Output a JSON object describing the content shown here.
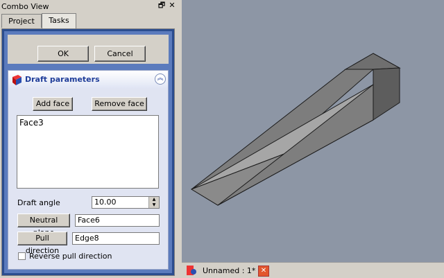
{
  "combo": {
    "title": "Combo View",
    "tabs": [
      {
        "label": "Project"
      },
      {
        "label": "Tasks"
      }
    ]
  },
  "dialog": {
    "ok_label": "OK",
    "cancel_label": "Cancel"
  },
  "draft": {
    "title": "Draft parameters",
    "add_face_label": "Add face",
    "remove_face_label": "Remove face",
    "faces": [
      "Face3"
    ],
    "draft_angle_label": "Draft angle",
    "draft_angle_value": "10.00",
    "neutral_plane_label": "Neutral plane",
    "neutral_plane_value": "Face6",
    "pull_direction_label": "Pull direction",
    "pull_direction_value": "Edge8",
    "reverse_label": "Reverse pull direction",
    "reverse_checked": false
  },
  "document": {
    "tab_label": "Unnamed : 1*"
  },
  "colors": {
    "viewport_bg": "#8d96a5",
    "panel_border": "#2b4d8f",
    "group_title": "#1f3d99",
    "close_icon": "#e2562d"
  }
}
